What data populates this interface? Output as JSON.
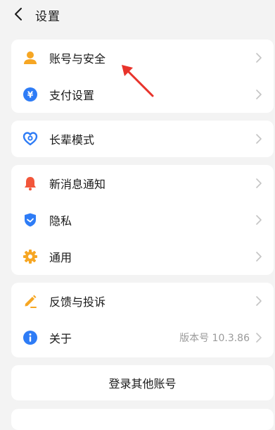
{
  "header": {
    "title": "设置",
    "back_icon": "chevron-left-icon"
  },
  "groups": [
    {
      "items": [
        {
          "label": "账号与安全",
          "icon": "person-icon",
          "color": "#f6a623"
        },
        {
          "label": "支付设置",
          "icon": "yuan-coin-icon",
          "color": "#2e7cf6"
        }
      ]
    },
    {
      "items": [
        {
          "label": "长辈模式",
          "icon": "heart-ring-icon",
          "color": "#2e7cf6"
        }
      ]
    },
    {
      "items": [
        {
          "label": "新消息通知",
          "icon": "bell-icon",
          "color": "#f2563a"
        },
        {
          "label": "隐私",
          "icon": "shield-icon",
          "color": "#2e7cf6"
        },
        {
          "label": "通用",
          "icon": "gear-icon",
          "color": "#f6a623"
        }
      ]
    },
    {
      "items": [
        {
          "label": "反馈与投诉",
          "icon": "pencil-icon",
          "color": "#f6a623"
        },
        {
          "label": "关于",
          "icon": "info-icon",
          "color": "#2e7cf6",
          "value": "版本号 10.3.86"
        }
      ]
    }
  ],
  "actions": {
    "switch_account_label": "登录其他账号"
  },
  "annotation": {
    "arrow_color": "#e8332b"
  }
}
